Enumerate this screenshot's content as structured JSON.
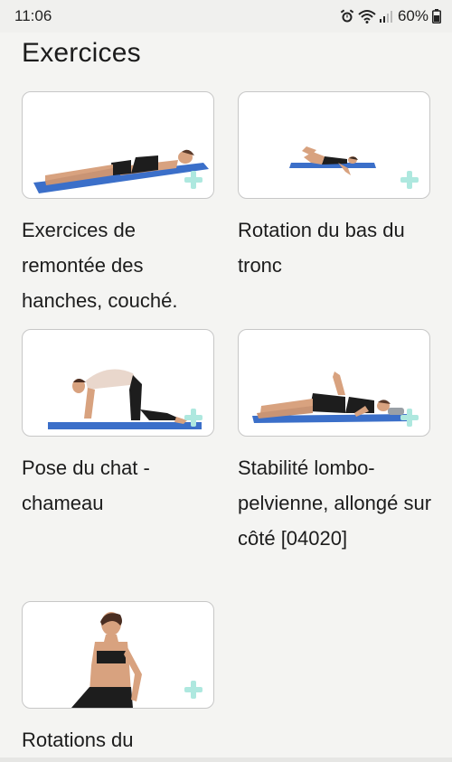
{
  "status_bar": {
    "time": "11:06",
    "battery": "60%",
    "icons": [
      "alarm-icon",
      "wifi-icon",
      "signal-icon",
      "battery-icon"
    ]
  },
  "page": {
    "title": "Exercices"
  },
  "exercises": [
    {
      "label": "Exercices de remontée des hanches, couché."
    },
    {
      "label": "Rotation du bas du tronc"
    },
    {
      "label": "Pose du chat - chameau"
    },
    {
      "label": "Stabilité lombo-pelvienne, allongé sur côté [04020]"
    },
    {
      "label": "Rotations du"
    }
  ],
  "colors": {
    "background": "#f4f4f2",
    "card_border": "#c7c7c7",
    "mat": "#3b6fc9",
    "add_icon": "#aee8df"
  }
}
